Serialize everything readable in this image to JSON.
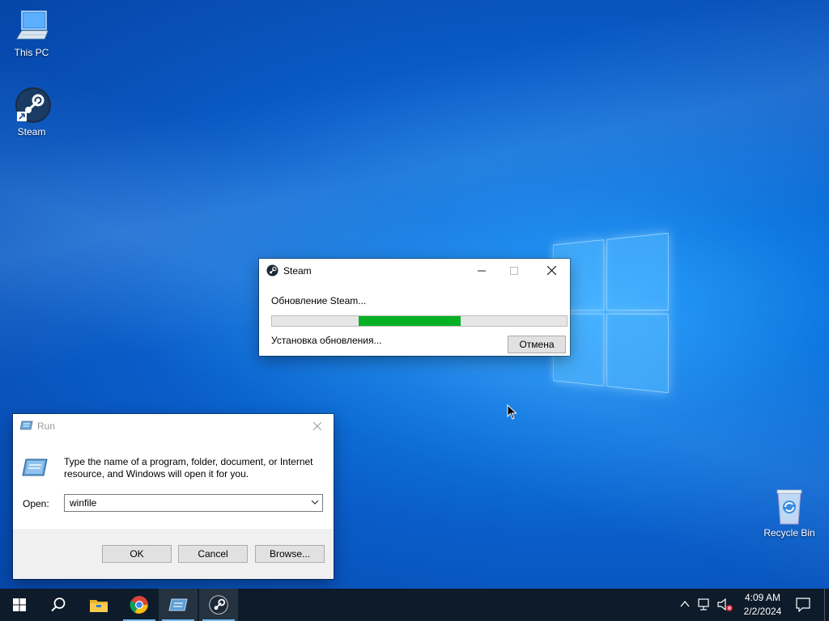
{
  "desktop": {
    "icons": [
      {
        "label": "This PC"
      },
      {
        "label": "Steam"
      },
      {
        "label": "Recycle Bin"
      }
    ]
  },
  "steam_dialog": {
    "title": "Steam",
    "status": "Обновление Steam...",
    "substatus": "Установка обновления...",
    "cancel_label": "Отмена",
    "progress_fill_start_pct": 29.4,
    "progress_fill_end_pct": 64,
    "accent": "#06b025"
  },
  "run_dialog": {
    "title": "Run",
    "description_line1": "Type the name of a program, folder, document, or Internet",
    "description_line2": "resource, and Windows will open it for you.",
    "open_label": "Open:",
    "open_value": "winfile",
    "ok_label": "OK",
    "cancel_label": "Cancel",
    "browse_label": "Browse..."
  },
  "taskbar": {
    "items": [
      "start-icon",
      "search-icon",
      "file-explorer-icon",
      "chrome-icon",
      "run-icon",
      "steam-icon"
    ],
    "time": "4:09 AM",
    "date": "2/2/2024"
  }
}
